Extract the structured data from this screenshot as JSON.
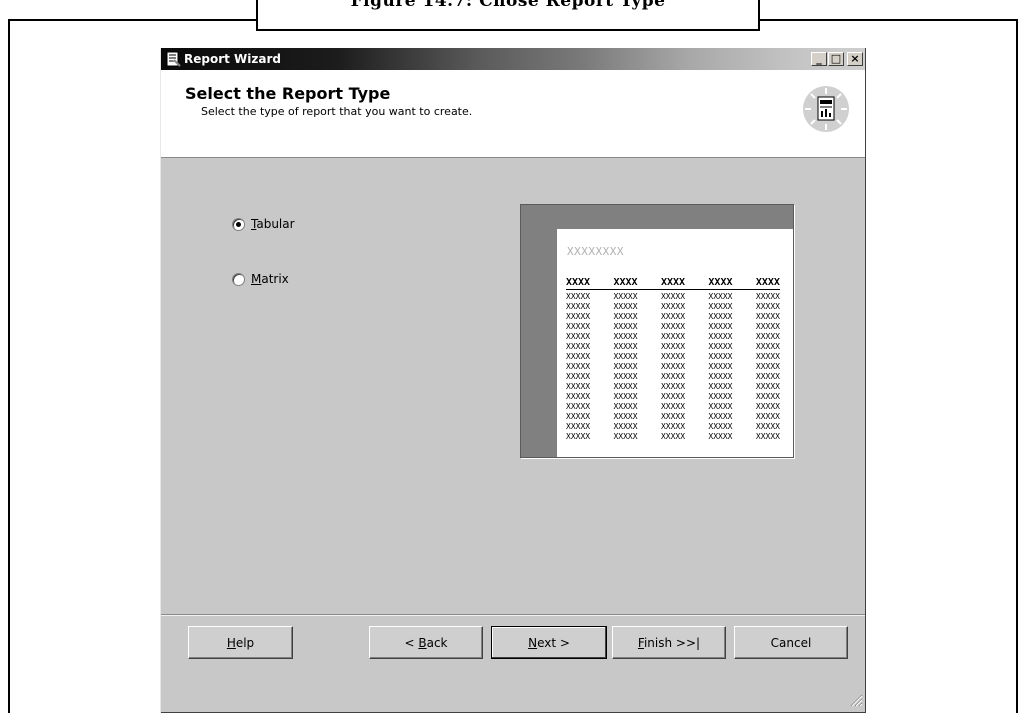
{
  "figure": {
    "caption": "Figure 14.7: Chose Report Type"
  },
  "window": {
    "title": "Report Wizard",
    "controls": {
      "minimize": "_",
      "maximize": "□",
      "close": "×"
    },
    "icons": {
      "app": "report-wizard-icon",
      "header": "report-document-icon"
    }
  },
  "header": {
    "title": "Select the Report Type",
    "subtitle": "Select the type of report that you want to create."
  },
  "options": [
    {
      "key": "T",
      "rest": "abular",
      "selected": true
    },
    {
      "key": "M",
      "rest": "atrix",
      "selected": false
    }
  ],
  "preview": {
    "title": "XXXXXXXX",
    "headers": [
      "XXXX",
      "XXXX",
      "XXXX",
      "XXXX",
      "XXXX"
    ],
    "cell": "XXXXX",
    "row_count": 15
  },
  "buttons": {
    "help": {
      "key": "H",
      "rest": "elp"
    },
    "back": {
      "pre": "< ",
      "key": "B",
      "rest": "ack"
    },
    "next": {
      "key": "N",
      "rest": "ext >"
    },
    "finish": {
      "key": "F",
      "rest": "inish >>|"
    },
    "cancel": "Cancel"
  }
}
